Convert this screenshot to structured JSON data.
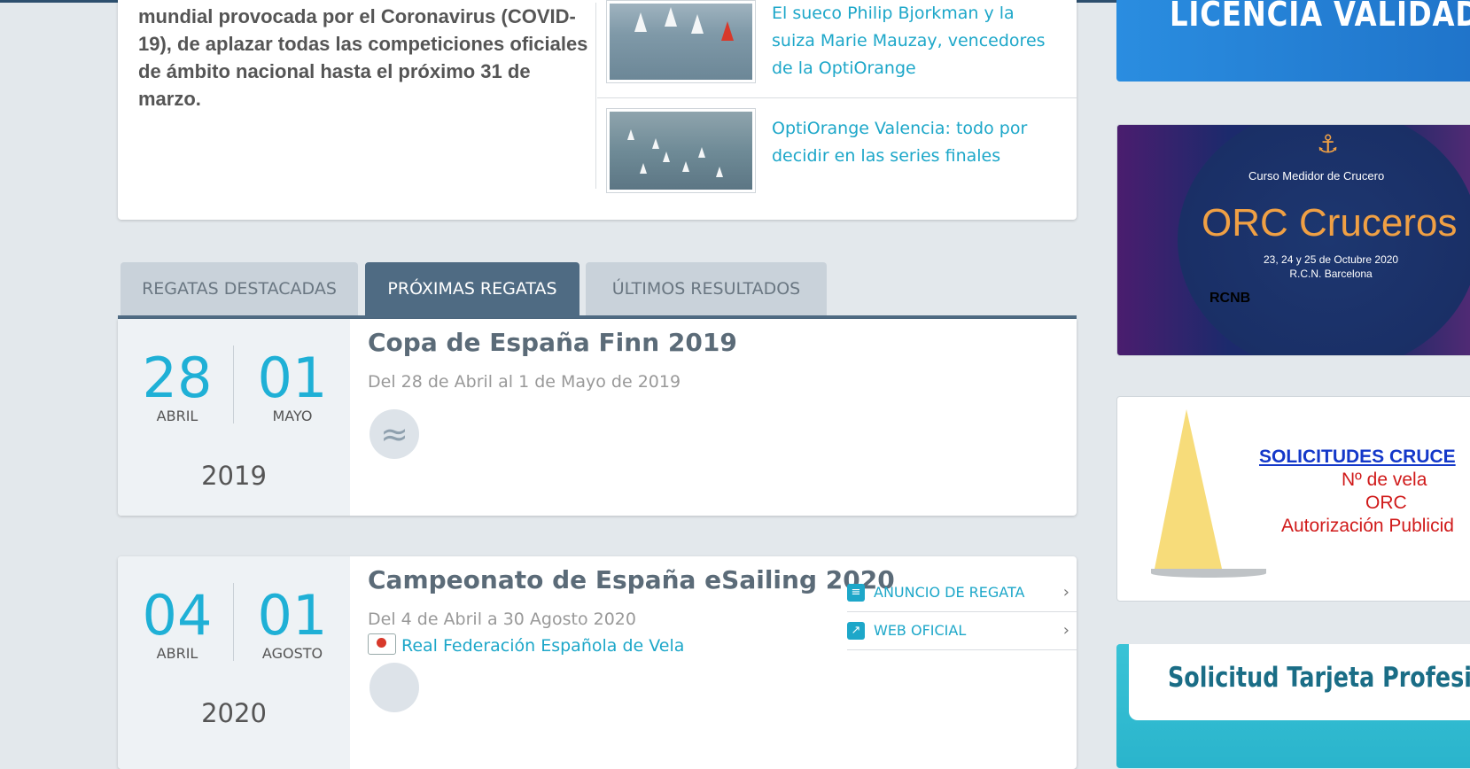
{
  "news": {
    "lead_text": "mundial provocada por el Coronavirus (COVID-19), de aplazar todas las competiciones oficiales de ámbito nacional hasta el próximo 31 de marzo.",
    "items": [
      {
        "title": "El sueco Philip Bjorkman y la suiza Marie Mauzay, vencedores de la OptiOrange"
      },
      {
        "title": "OptiOrange Valencia: todo por decidir en las series finales"
      }
    ]
  },
  "tabs": [
    {
      "label": "REGATAS DESTACADAS",
      "active": false
    },
    {
      "label": "PRÓXIMAS REGATAS",
      "active": true
    },
    {
      "label": "ÚLTIMOS RESULTADOS",
      "active": false
    }
  ],
  "events": [
    {
      "start_day": "28",
      "start_month": "ABRIL",
      "end_day": "01",
      "end_month": "MAYO",
      "year": "2019",
      "title": "Copa de España Finn 2019",
      "dates": "Del 28 de Abril al 1 de Mayo de 2019",
      "class_icon": "wave-icon"
    },
    {
      "start_day": "04",
      "start_month": "ABRIL",
      "end_day": "01",
      "end_month": "AGOSTO",
      "year": "2020",
      "title": "Campeonato de España eSailing 2020",
      "dates": "Del 4 de Abril a 30 Agosto 2020",
      "organizer": "Real Federación Española de Vela",
      "links": [
        {
          "label": "ANUNCIO DE REGATA",
          "icon": "document-icon"
        },
        {
          "label": "WEB OFICIAL",
          "icon": "external-link-icon"
        }
      ]
    }
  ],
  "sidebar": {
    "banner_license": "LICENCIA VALIDADA",
    "banner_orc": {
      "course": "Curso  Medidor de Crucero",
      "title": "ORC Cruceros",
      "dates": "23, 24 y 25 de Octubre 2020",
      "place": "R.C.N. Barcelona",
      "club": "RCNB"
    },
    "banner_solicitudes": {
      "heading": "SOLICITUDES CRUCE",
      "line1": "Nº de vela",
      "line2": "ORC",
      "line3": "Autorización Publicid"
    },
    "banner_tarjeta": "Solicitud Tarjeta Profesiona"
  },
  "colors": {
    "accent": "#1da7c9",
    "tab_active": "#4f6b83",
    "tab_inactive": "#c9d2da",
    "background": "#e3e8ec"
  }
}
